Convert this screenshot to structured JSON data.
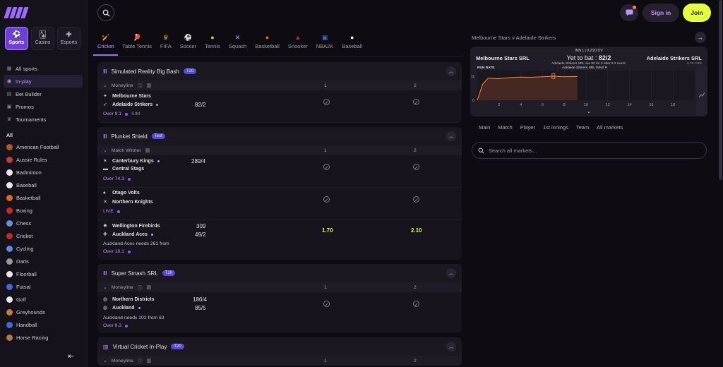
{
  "topbar": {
    "signin": "Sign in",
    "join": "Join"
  },
  "sidebar": {
    "tiles": [
      {
        "label": "Sports",
        "icon": "soccer-ball-icon"
      },
      {
        "label": "Casino",
        "icon": "casino-chip-icon"
      },
      {
        "label": "Esports",
        "icon": "gamepad-icon"
      }
    ],
    "nav": [
      {
        "label": "All sports"
      },
      {
        "label": "In-play"
      },
      {
        "label": "Bet Builder"
      },
      {
        "label": "Promos"
      },
      {
        "label": "Tournaments"
      }
    ],
    "all_heading": "All",
    "sports": [
      {
        "label": "American Football",
        "color": "#b2572a"
      },
      {
        "label": "Aussie Rules",
        "color": "#c23c3c"
      },
      {
        "label": "Badminton",
        "color": "#e9e9e9"
      },
      {
        "label": "Baseball",
        "color": "#e9e9e9"
      },
      {
        "label": "Basketball",
        "color": "#e06a1c"
      },
      {
        "label": "Boxing",
        "color": "#c62828"
      },
      {
        "label": "Chess",
        "color": "#6b8fd6"
      },
      {
        "label": "Cricket",
        "color": "#c62828"
      },
      {
        "label": "Cycling",
        "color": "#5b8ae0"
      },
      {
        "label": "Darts",
        "color": "#9a9a9a"
      },
      {
        "label": "Floorball",
        "color": "#e9e9e9"
      },
      {
        "label": "Futsal",
        "color": "#3f6dd8"
      },
      {
        "label": "Golf",
        "color": "#e9e9e9"
      },
      {
        "label": "Greyhounds",
        "color": "#c77a3c"
      },
      {
        "label": "Handball",
        "color": "#3f6dd8"
      },
      {
        "label": "Horse Racing",
        "color": "#b57a45"
      }
    ]
  },
  "tabs": [
    {
      "label": "Cricket",
      "icon": "cricket-bat-icon"
    },
    {
      "label": "Table Tennis",
      "icon": "table-tennis-icon"
    },
    {
      "label": "FIFA",
      "icon": "trophy-icon"
    },
    {
      "label": "Soccer",
      "icon": "soccer-ball-icon"
    },
    {
      "label": "Tennis",
      "icon": "tennis-ball-icon"
    },
    {
      "label": "Squash",
      "icon": "squash-racket-icon"
    },
    {
      "label": "Basketball",
      "icon": "basketball-icon"
    },
    {
      "label": "Snooker",
      "icon": "snooker-icon"
    },
    {
      "label": "NBA2K",
      "icon": "nba2k-icon"
    },
    {
      "label": "Baseball",
      "icon": "baseball-icon"
    }
  ],
  "competitions": [
    {
      "name": "Simulated Reality Big Bash",
      "tag": "T20",
      "market": "Moneyline",
      "col1": "1",
      "col2": "2",
      "events": [
        {
          "home": "Melbourne Stars",
          "away": "Adelaide Strikers",
          "away_score": "82/2",
          "meta": "Over 9.1",
          "meta2": "SIM"
        }
      ]
    },
    {
      "name": "Plunket Shield",
      "tag": "Test",
      "market": "Match Winner",
      "col1": "1",
      "col2": "2",
      "events": [
        {
          "home": "Canterbury Kings",
          "away": "Central Stags",
          "home_score": "289/4",
          "meta": "Over 74.3"
        },
        {
          "home": "Otago Volts",
          "away": "Northern Knights",
          "meta": "LIVE"
        },
        {
          "home": "Wellington Firebirds",
          "away": "Auckland Aces",
          "home_score": "309",
          "away_score": "49/2",
          "odd1": "1.70",
          "odd2": "2.10",
          "needs": "Auckland Aces needs 261 from",
          "meta": "Over 18.1"
        }
      ]
    },
    {
      "name": "Super Smash SRL",
      "tag": "T20",
      "market": "Moneyline",
      "col1": "1",
      "col2": "2",
      "events": [
        {
          "home": "Northern Districts",
          "away": "Auckland",
          "home_score": "186/4",
          "away_score": "85/5",
          "needs": "Auckland needs 102 from 63",
          "meta": "Over 9.3"
        }
      ]
    },
    {
      "name": "Virtual Cricket In-Play",
      "tag": "T20",
      "market": "Moneyline",
      "col1": "1",
      "col2": "2"
    }
  ],
  "right": {
    "match_title": "Melbourne Stars v Adelaide Strikers",
    "innings": "INN 1 | 9.2/20 OV",
    "home": "Melbourne Stars SRL",
    "away": "Adelaide Strikers SRL",
    "ytb_label": "Yet to bat : ",
    "ytb_score": "82/2",
    "sub": "Adelaide Strikers SRL are 82 for 2 after 9.2 overs.",
    "crr": "8.79 CRR",
    "tabs": [
      "Main",
      "Match",
      "Player",
      "1st innings",
      "Team",
      "All markets"
    ],
    "search_placeholder": "Search all markets..."
  },
  "chart_data": {
    "type": "area",
    "title": "",
    "xlabel": "",
    "ylabel": "RUN RATE",
    "series_label": "Adelaide Strikers SRL INNS",
    "x_ticks": [
      "2",
      "4",
      "6",
      "8",
      "10",
      "12",
      "14",
      "16",
      "18"
    ],
    "y_ticks": [
      "0",
      "11"
    ],
    "xlim": [
      0,
      20
    ],
    "ylim": [
      0,
      11
    ],
    "x": [
      0,
      0.5,
      1,
      2,
      3,
      4,
      5,
      6,
      7,
      8,
      9,
      9.2
    ],
    "values": [
      0,
      6,
      8.2,
      8.0,
      8.4,
      8.6,
      8.5,
      8.7,
      8.9,
      8.7,
      8.8,
      8.79
    ],
    "markers": [
      {
        "x": 7,
        "y": 9.4
      },
      {
        "x": 7,
        "y": 8.5
      }
    ],
    "line_color": "#ff8a3d"
  }
}
